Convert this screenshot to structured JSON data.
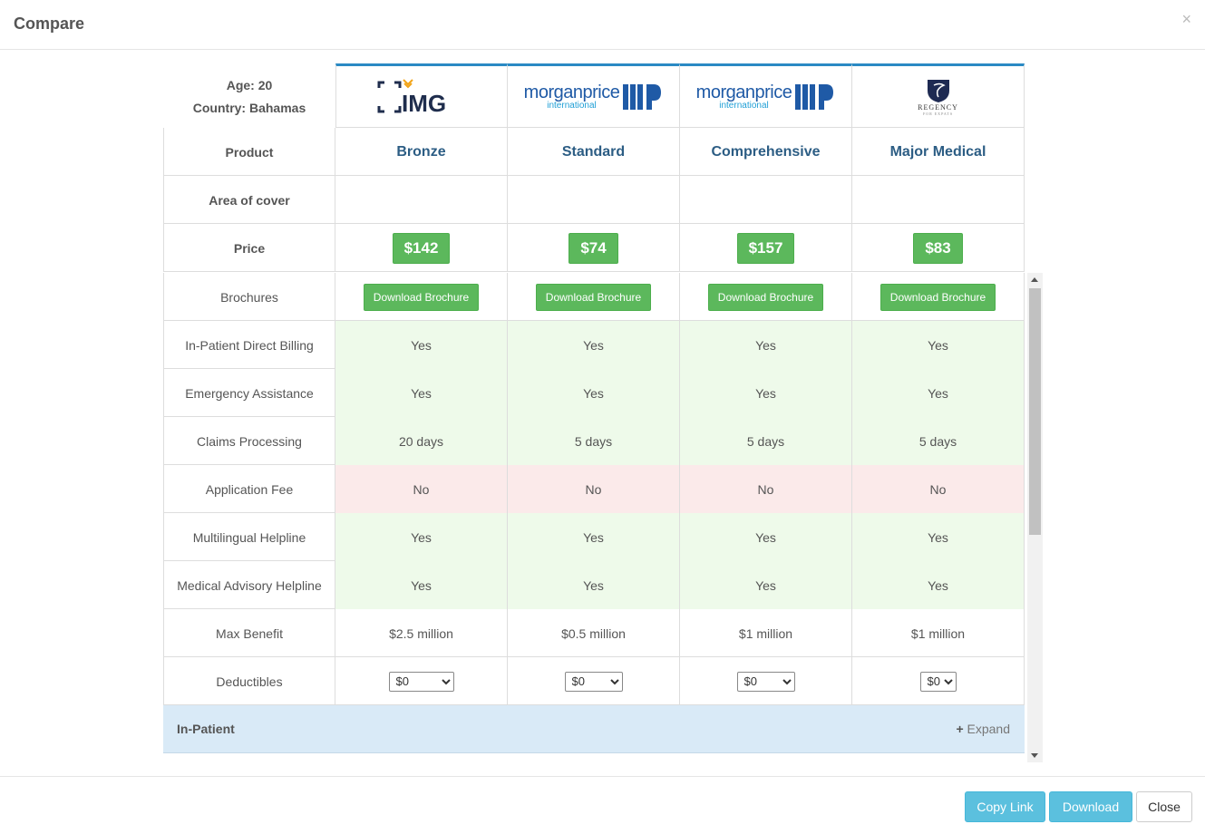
{
  "modal": {
    "title": "Compare",
    "close_symbol": "×"
  },
  "meta": {
    "age_line": "Age: 20",
    "country_line": "Country: Bahamas"
  },
  "providers": [
    {
      "logo_text": "IMG",
      "logo_icon": "img-logo"
    },
    {
      "logo_big": "morganprice",
      "logo_small": "international",
      "logo_icon": "morgan-price-logo"
    },
    {
      "logo_big": "morganprice",
      "logo_small": "international",
      "logo_icon": "morgan-price-logo"
    },
    {
      "logo_line1": "REGENCY",
      "logo_line2": "FOR EXPATS",
      "logo_icon": "regency-logo"
    }
  ],
  "rows": {
    "product": {
      "label": "Product",
      "values": [
        "Bronze",
        "Standard",
        "Comprehensive",
        "Major Medical"
      ]
    },
    "area": {
      "label": "Area of cover",
      "values": [
        "",
        "",
        "",
        ""
      ]
    },
    "price": {
      "label": "Price",
      "values": [
        "$142",
        "$74",
        "$157",
        "$83"
      ]
    },
    "brochures": {
      "label": "Brochures",
      "button_label": "Download Brochure"
    },
    "inpatient_billing": {
      "label": "In-Patient Direct Billing",
      "values": [
        "Yes",
        "Yes",
        "Yes",
        "Yes"
      ],
      "status": "positive"
    },
    "emergency": {
      "label": "Emergency Assistance",
      "values": [
        "Yes",
        "Yes",
        "Yes",
        "Yes"
      ],
      "status": "positive"
    },
    "claims": {
      "label": "Claims Processing",
      "values": [
        "20 days",
        "5 days",
        "5 days",
        "5 days"
      ],
      "status": "positive"
    },
    "app_fee": {
      "label": "Application Fee",
      "values": [
        "No",
        "No",
        "No",
        "No"
      ],
      "status": "negative"
    },
    "multilingual": {
      "label": "Multilingual Helpline",
      "values": [
        "Yes",
        "Yes",
        "Yes",
        "Yes"
      ],
      "status": "positive"
    },
    "medical_advisory": {
      "label": "Medical Advisory Helpline",
      "values": [
        "Yes",
        "Yes",
        "Yes",
        "Yes"
      ],
      "status": "positive"
    },
    "max_benefit": {
      "label": "Max Benefit",
      "values": [
        "$2.5 million",
        "$0.5 million",
        "$1 million",
        "$1 million"
      ]
    },
    "deductibles": {
      "label": "Deductibles",
      "values": [
        "$0",
        "$0",
        "$0",
        "$0"
      ]
    }
  },
  "section": {
    "label": "In-Patient",
    "expand_symbol": "+",
    "expand_label": "Expand"
  },
  "footer": {
    "copy_link": "Copy Link",
    "download": "Download",
    "close": "Close"
  },
  "colors": {
    "accent": "#2a8ac4",
    "success": "#5cb85c",
    "info": "#5bc0de",
    "positive_bg": "#eefaea",
    "negative_bg": "#fbeaea",
    "section_bg": "#d9eaf7",
    "product_text": "#2c5d84"
  }
}
